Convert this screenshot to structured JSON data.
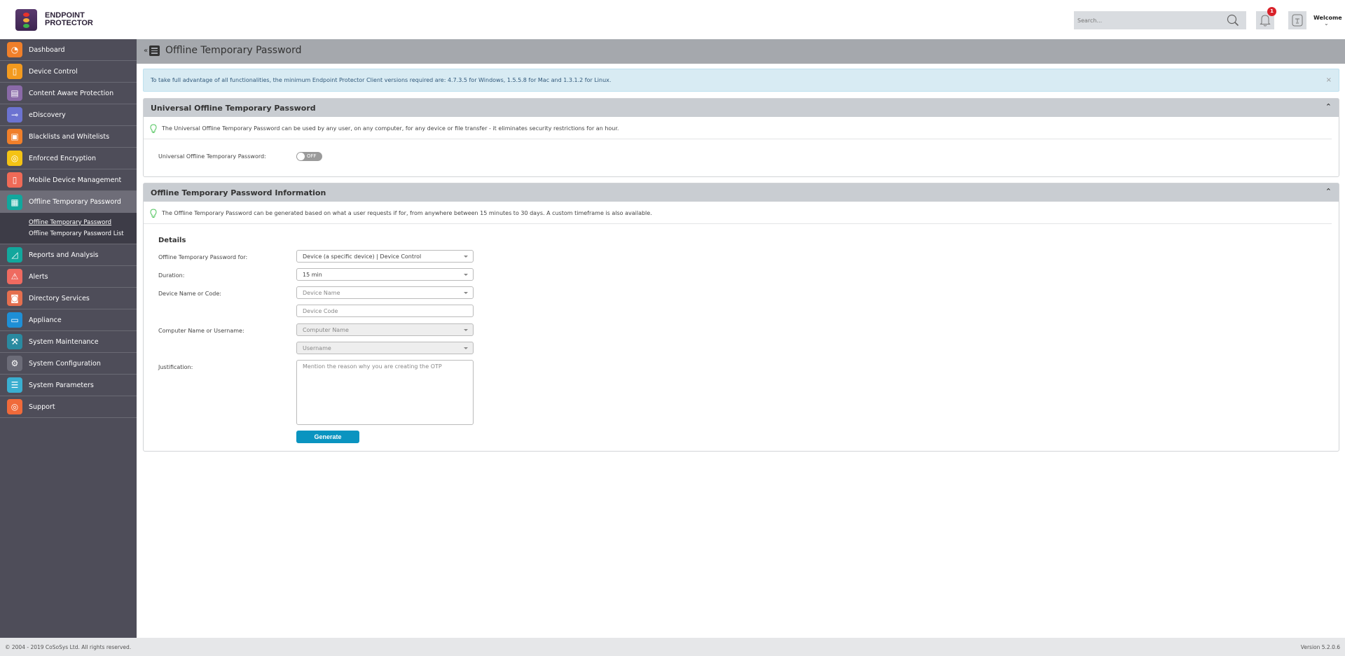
{
  "app": {
    "brand_line1": "ENDPOINT",
    "brand_line2": "PROTECTOR"
  },
  "header": {
    "search_placeholder": "Search...",
    "notifications_count": "1",
    "user_label": "Welcome",
    "user_chevron": "⌄"
  },
  "sidebar": {
    "items": [
      {
        "label": "Dashboard",
        "icon": "dashboard-icon",
        "color": "#f07f2a",
        "glyph": "◔"
      },
      {
        "label": "Device Control",
        "icon": "usb-icon",
        "color": "#f39a1f",
        "glyph": "▯"
      },
      {
        "label": "Content Aware Protection",
        "icon": "document-search-icon",
        "color": "#8a6aa8",
        "glyph": "▤"
      },
      {
        "label": "eDiscovery",
        "icon": "telescope-icon",
        "color": "#6c73d1",
        "glyph": "⊸"
      },
      {
        "label": "Blacklists and Whitelists",
        "icon": "list-window-icon",
        "color": "#f07f2a",
        "glyph": "▣"
      },
      {
        "label": "Enforced Encryption",
        "icon": "encryption-icon",
        "color": "#f4c314",
        "glyph": "◎"
      },
      {
        "label": "Mobile Device Management",
        "icon": "mobile-devices-icon",
        "color": "#ef6a57",
        "glyph": "▯"
      },
      {
        "label": "Offline Temporary Password",
        "icon": "shield-keypad-icon",
        "color": "#12a79d",
        "glyph": "▦",
        "active": true
      },
      {
        "label": "Reports and Analysis",
        "icon": "chart-icon",
        "color": "#12a79d",
        "glyph": "◿"
      },
      {
        "label": "Alerts",
        "icon": "warning-icon",
        "color": "#ef6a60",
        "glyph": "⚠"
      },
      {
        "label": "Directory Services",
        "icon": "briefcase-icon",
        "color": "#e56f4f",
        "glyph": "◙"
      },
      {
        "label": "Appliance",
        "icon": "appliance-icon",
        "color": "#1e8fd6",
        "glyph": "▭"
      },
      {
        "label": "System Maintenance",
        "icon": "tools-icon",
        "color": "#2a8aa0",
        "glyph": "⚒"
      },
      {
        "label": "System Configuration",
        "icon": "gear-icon",
        "color": "#6c6c78",
        "glyph": "⚙"
      },
      {
        "label": "System Parameters",
        "icon": "list-icon",
        "color": "#3aaed0",
        "glyph": "☰"
      },
      {
        "label": "Support",
        "icon": "lifebuoy-icon",
        "color": "#f06a3a",
        "glyph": "◎"
      }
    ],
    "subitems": [
      {
        "label": "Offline Temporary Password",
        "current": true
      },
      {
        "label": "Offline Temporary Password List",
        "current": false
      }
    ]
  },
  "page": {
    "collapse_glyph": "«",
    "title": "Offline Temporary Password",
    "alert_text": "To take full advantage of all functionalities, the minimum Endpoint Protector Client versions required are: 4.7.3.5 for Windows, 1.5.5.8 for Mac and 1.3.1.2 for Linux.",
    "alert_close": "×"
  },
  "universal_panel": {
    "title": "Universal Offline Temporary Password",
    "chevron": "⌃",
    "hint": "The Universal Offline Temporary Password can be used by any user, on any computer, for any device or file transfer - it eliminates security restrictions for an hour.",
    "toggle_label": "Universal Offline Temporary Password:",
    "toggle_state": "OFF"
  },
  "info_panel": {
    "title": "Offline Temporary Password Information",
    "chevron": "⌃",
    "hint": "The Offline Temporary Password can be generated based on what a user requests if for, from anywhere between 15 minutes to 30 days. A custom timeframe is also available.",
    "details_heading": "Details",
    "fields": {
      "otp_for_label": "Offline Temporary Password for:",
      "otp_for_value": "Device (a specific device) | Device Control",
      "duration_label": "Duration:",
      "duration_value": "15 min",
      "device_label": "Device Name or Code:",
      "device_name_placeholder": "Device Name",
      "device_code_placeholder": "Device Code",
      "computer_label": "Computer Name or Username:",
      "computer_name_placeholder": "Computer Name",
      "username_placeholder": "Username",
      "justification_label": "Justification:",
      "justification_placeholder": "Mention the reason why you are creating the OTP"
    },
    "generate_label": "Generate"
  },
  "footer": {
    "copyright": "© 2004 - 2019 CoSoSys Ltd. All rights reserved.",
    "version": "Version 5.2.0.6"
  }
}
